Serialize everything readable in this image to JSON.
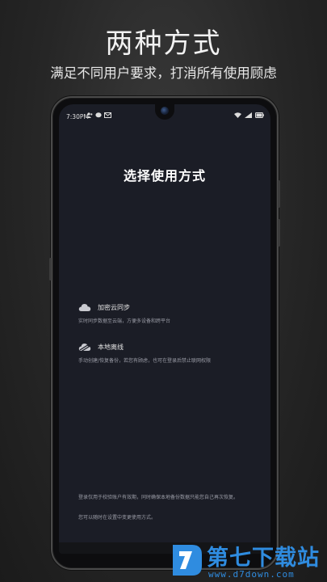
{
  "promo": {
    "title": "两种方式",
    "subtitle": "满足不同用户要求，打消所有使用顾虑"
  },
  "statusbar": {
    "time": "7:30PM"
  },
  "screen": {
    "title": "选择使用方式",
    "options": [
      {
        "icon": "cloud-icon",
        "label": "加密云同步",
        "description": "实时同步数据至云端，方便多设备和跨平台"
      },
      {
        "icon": "offline-cloud-icon",
        "label": "本地离线",
        "description": "手动创建/恢复备份，若您有顾虑，也可在登录后禁止联网权限"
      }
    ],
    "footer_note_1": "登录仅用于校验账户有效期，同时确保本地备份数据只能您自己再次恢复。",
    "footer_note_2": "您可以随时在设置中变更使用方式。"
  },
  "watermark": {
    "name": "第七下载站",
    "url": "www.d7down.com"
  },
  "colors": {
    "screen_bg": "#1b1d26",
    "watermark_blue": "#2f8ce0"
  }
}
